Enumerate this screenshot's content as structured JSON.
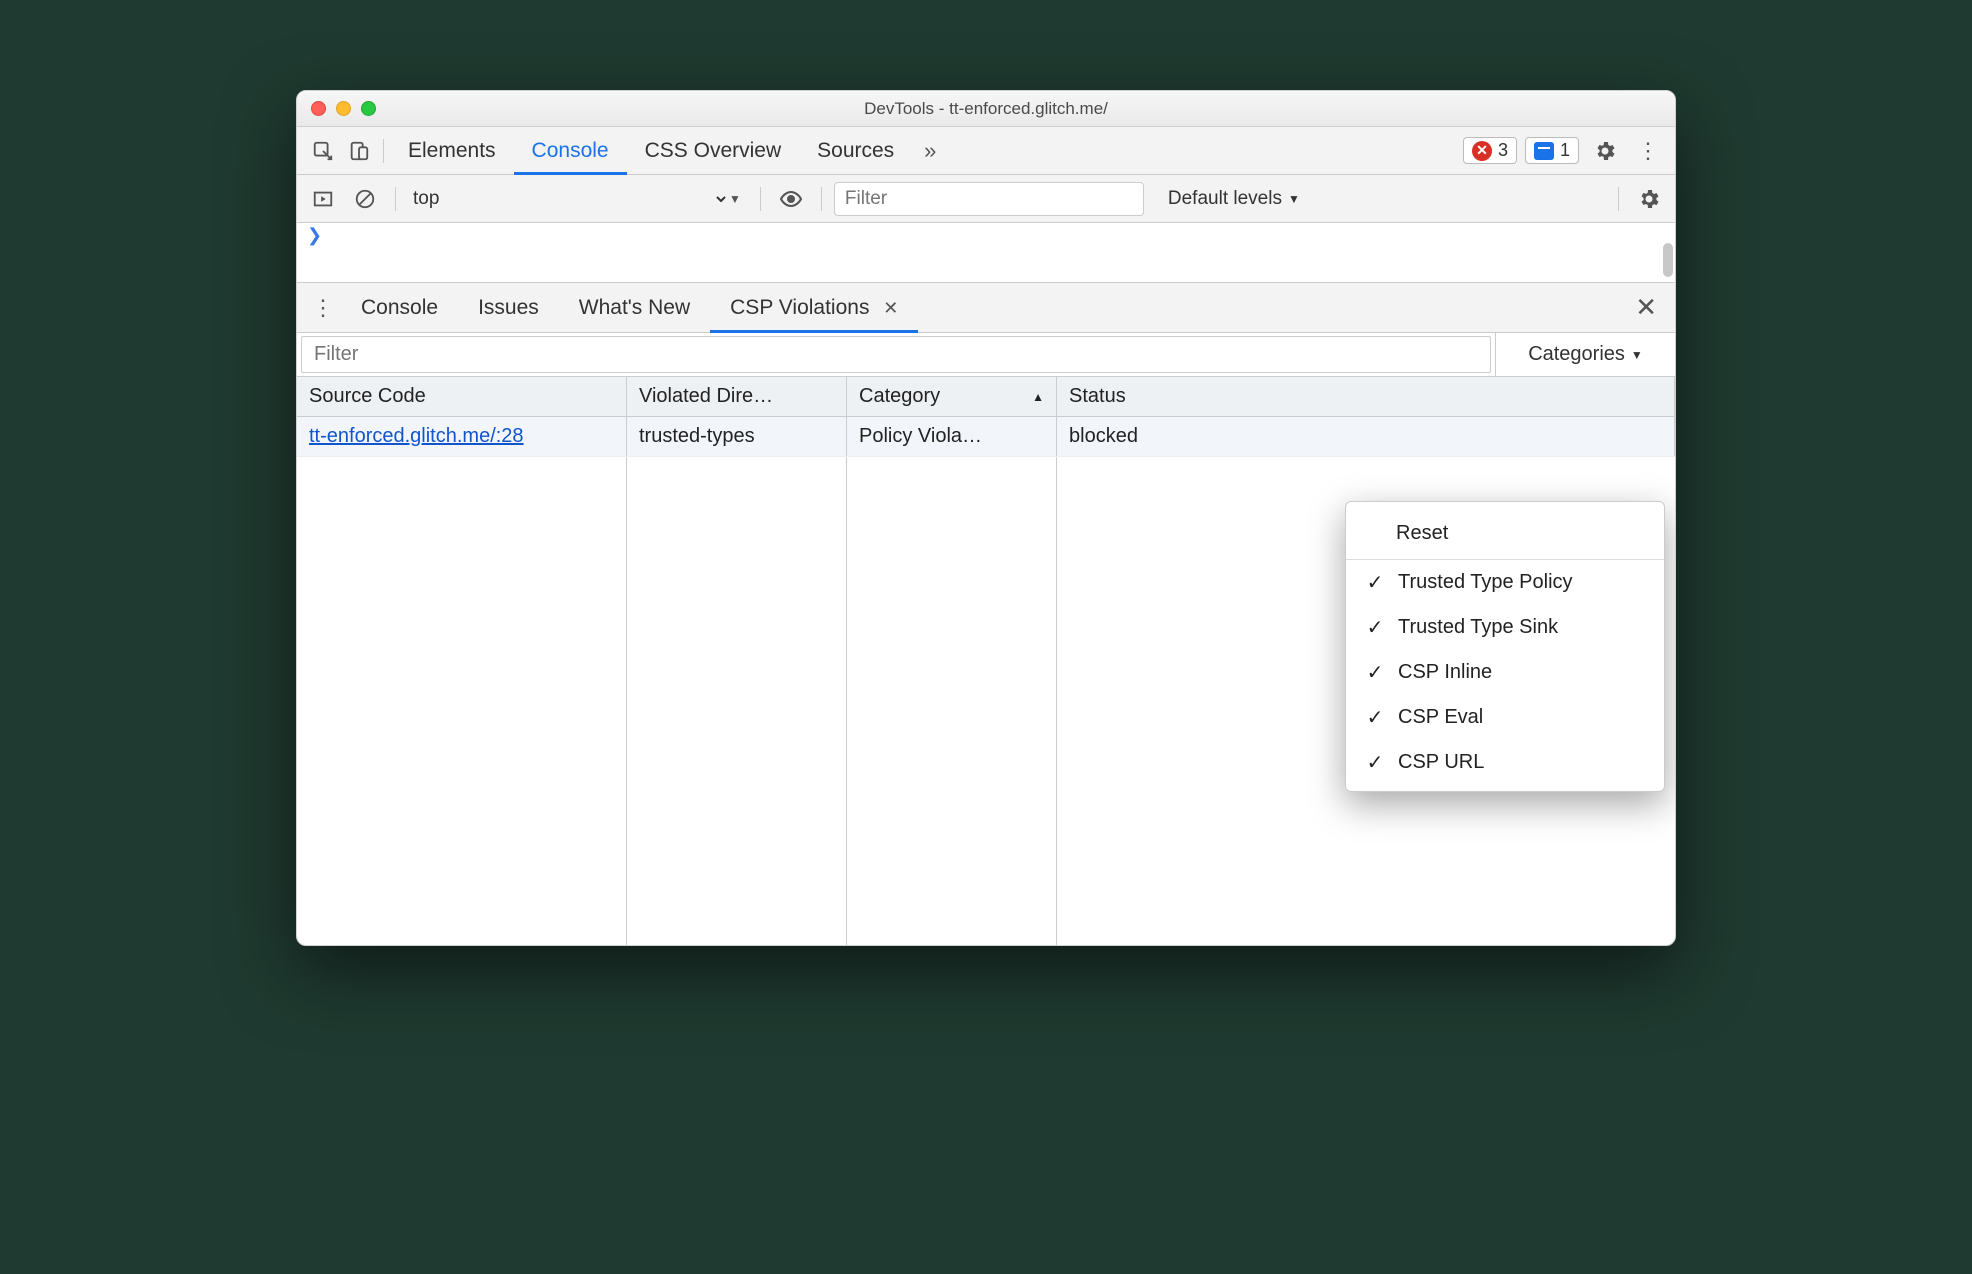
{
  "window": {
    "title": "DevTools - tt-enforced.glitch.me/"
  },
  "main_tabs": {
    "items": [
      "Elements",
      "Console",
      "CSS Overview",
      "Sources"
    ],
    "active_index": 1,
    "errors": "3",
    "messages": "1"
  },
  "console_toolbar": {
    "context": "top",
    "filter_placeholder": "Filter",
    "levels": "Default levels"
  },
  "drawer_tabs": {
    "items": [
      "Console",
      "Issues",
      "What's New",
      "CSP Violations"
    ],
    "active_index": 3
  },
  "violations": {
    "filter_placeholder": "Filter",
    "categories_label": "Categories",
    "columns": [
      "Source Code",
      "Violated Dire…",
      "Category",
      "Status"
    ],
    "sort_col": 2,
    "rows": [
      {
        "source": "tt-enforced.glitch.me/:28",
        "directive": "trusted-types",
        "category": "Policy Viola…",
        "status": "blocked"
      }
    ]
  },
  "categories_menu": {
    "reset": "Reset",
    "items": [
      {
        "checked": true,
        "label": "Trusted Type Policy"
      },
      {
        "checked": true,
        "label": "Trusted Type Sink"
      },
      {
        "checked": true,
        "label": "CSP Inline"
      },
      {
        "checked": true,
        "label": "CSP Eval"
      },
      {
        "checked": true,
        "label": "CSP URL"
      }
    ]
  }
}
